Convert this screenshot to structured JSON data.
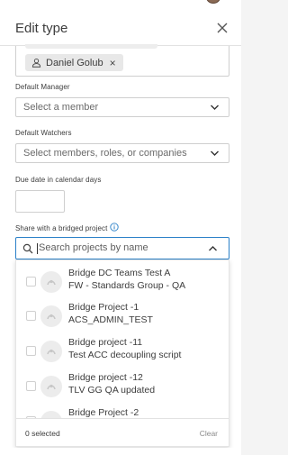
{
  "header": {
    "title": "Edit type"
  },
  "assignee": {
    "chip_label": "Daniel Golub",
    "chip_remove": "×"
  },
  "default_manager": {
    "label": "Default Manager",
    "placeholder": "Select a member"
  },
  "default_watchers": {
    "label": "Default Watchers",
    "placeholder": "Select members, roles, or companies"
  },
  "due_date": {
    "label": "Due date in calendar days",
    "value": ""
  },
  "share": {
    "label": "Share with a bridged project",
    "search_placeholder": "Search projects by name",
    "search_cursor_letter": "S",
    "search_rest": "earch projects by name",
    "projects": [
      {
        "name": "Bridge DC Teams Test A",
        "sub": "FW - Standards Group - QA",
        "checked": false
      },
      {
        "name": "Bridge Project -1",
        "sub": "ACS_ADMIN_TEST",
        "checked": false
      },
      {
        "name": "Bridge project -11",
        "sub": "Test ACC decoupling script",
        "checked": false
      },
      {
        "name": "Bridge project -12",
        "sub": "TLV GG QA updated",
        "checked": false
      },
      {
        "name": "Bridge Project -2",
        "sub": "",
        "checked": false
      }
    ],
    "selected_count": "0 selected",
    "clear_label": "Clear"
  },
  "icons": {
    "close": "close-icon",
    "person": "person-icon",
    "chevron": "chevron-down-icon",
    "info": "info-icon",
    "search": "search-icon",
    "bridge": "bridge-icon"
  },
  "colors": {
    "accent": "#2a80c8",
    "text": "#3c3c3c",
    "border": "#cfcfcf"
  }
}
